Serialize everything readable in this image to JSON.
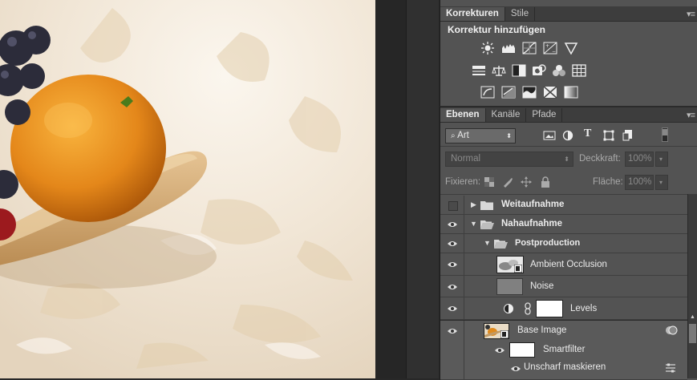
{
  "panels": {
    "adjustments": {
      "tabs": [
        "Korrekturen",
        "Stile"
      ],
      "title": "Korrektur hinzufügen",
      "icons_row1": [
        "brightness-icon",
        "levels-icon",
        "curves-icon",
        "exposure-icon",
        "vibrance-icon"
      ],
      "icons_row2": [
        "hue-saturation-icon",
        "color-balance-icon",
        "black-white-icon",
        "photo-filter-icon",
        "channel-mixer-icon",
        "color-lookup-icon"
      ],
      "icons_row3": [
        "invert-icon",
        "posterize-icon",
        "threshold-icon",
        "selective-color-icon",
        "gradient-map-icon"
      ]
    },
    "layers": {
      "tabs": [
        "Ebenen",
        "Kanäle",
        "Pfade"
      ],
      "filter_kind": "Art",
      "blend_mode": "Normal",
      "opacity_label": "Deckkraft:",
      "opacity_value": "100%",
      "lock_label": "Fixieren:",
      "fill_label": "Fläche:",
      "fill_value": "100%",
      "items": [
        {
          "name": "Weitaufnahme",
          "type": "group",
          "visible": false,
          "expanded": false
        },
        {
          "name": "Nahaufnahme",
          "type": "group",
          "visible": true,
          "expanded": true
        },
        {
          "name": "Postproduction",
          "type": "group",
          "visible": true,
          "expanded": true
        },
        {
          "name": "Ambient Occlusion",
          "type": "smart",
          "visible": true
        },
        {
          "name": "Noise",
          "type": "pixel",
          "visible": true
        },
        {
          "name": "Levels",
          "type": "adjustment",
          "visible": true
        },
        {
          "name": "Base Image",
          "type": "smart",
          "visible": true
        },
        {
          "name": "Smartfilter",
          "type": "filter-mask",
          "visible": true
        },
        {
          "name": "Unscharf maskieren",
          "type": "filter",
          "visible": true
        }
      ]
    }
  },
  "colors": {
    "panel_bg": "#535353",
    "tab_bar": "#3d3d3d",
    "selected_row": "#6b6b6b",
    "canvas_bg": "#f2e9dc",
    "orange": "#e8901c"
  }
}
